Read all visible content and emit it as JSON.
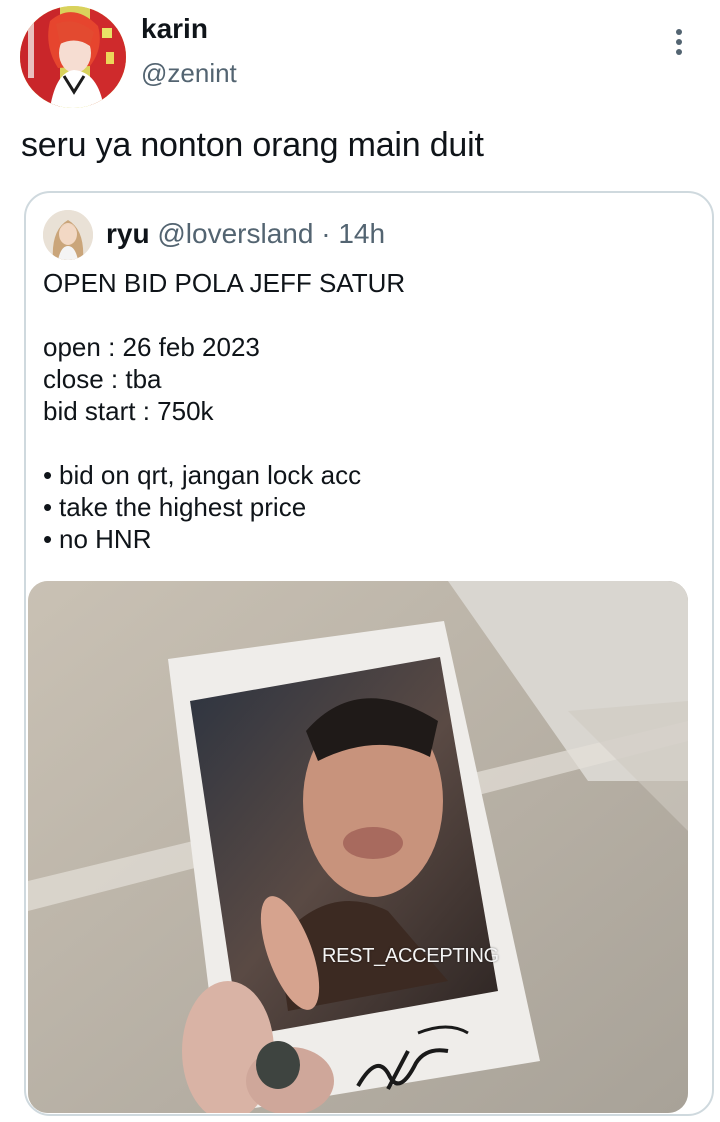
{
  "tweet": {
    "author": {
      "display_name": "karin",
      "handle": "@zenint",
      "avatar": "anime-character-avatar"
    },
    "text": "seru ya nonton orang main duit",
    "more_icon": "more-vertical-icon"
  },
  "quoted_tweet": {
    "author": {
      "display_name": "ryu",
      "handle": "@loversland",
      "avatar": "profile-photo-avatar"
    },
    "separator": "·",
    "time": "14h",
    "lines": [
      "OPEN BID POLA JEFF SATUR",
      "open : 26 feb 2023",
      "close : tba",
      "bid start : 750k"
    ],
    "bullets": [
      "bid on qrt, jangan lock acc",
      "take the highest price",
      "no HNR"
    ],
    "media": {
      "description_icon": "polaroid-photo",
      "watermark": "REST_ACCEPTING"
    }
  },
  "colors": {
    "text_primary": "#0f1419",
    "text_secondary": "#536471",
    "border": "#cfd9de"
  }
}
